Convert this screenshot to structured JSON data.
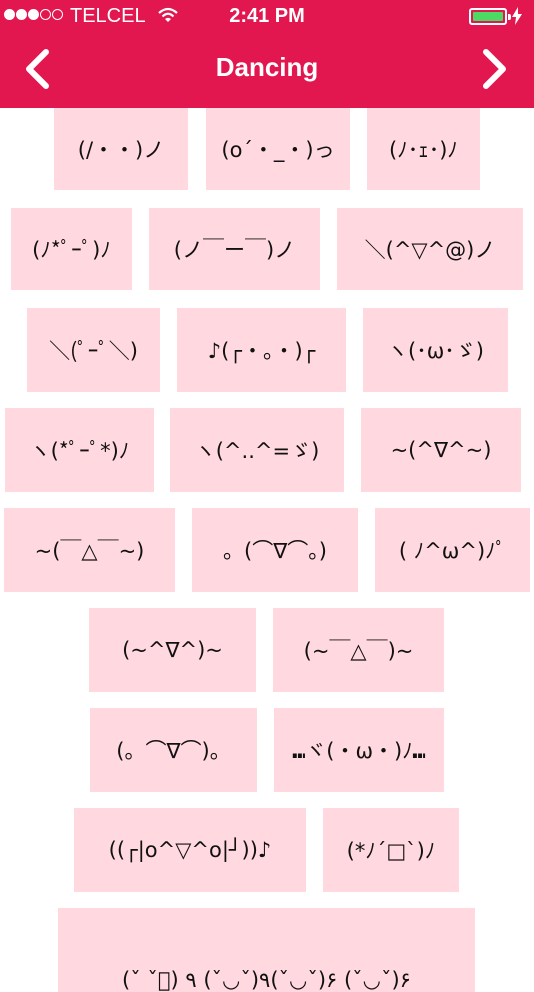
{
  "status_bar": {
    "carrier": "TELCEL",
    "time": "2:41 PM",
    "signal_bars": 3,
    "signal_icon": "signal-dots-icon",
    "wifi_icon": "wifi-icon",
    "battery_level": 1.0,
    "battery_color": "#4cd964",
    "charging_icon": "bolt-icon"
  },
  "nav": {
    "title": "Dancing",
    "back_icon": "chevron-left-icon",
    "next_icon": "chevron-right-icon",
    "color": "#e3174f"
  },
  "emoticons": [
    "(/・・)ノ",
    "(o´・_・)っ",
    "(ﾉ･ｪ･)ﾉ",
    "(ﾉ*ﾟｰﾟ)ﾉ",
    "(ノ￣ー￣)ノ",
    "＼(^▽^@)ノ",
    "＼(ﾟｰﾟ＼)",
    "♪(┌・。・)┌",
    "ヽ(･ω･ゞ)",
    "ヽ(*ﾟｰﾟ*)ﾉ",
    "ヽ(^..^=ゞ)",
    "~(^∇^~)",
    "~(￣△￣~)",
    "。(⌒∇⌒。)",
    "( ﾉ^ω^)ﾉﾟ",
    "(~^∇^)~",
    "(~￣△￣)~",
    "(。⌒∇⌒)。",
    "⑉ヾ(・ω・)ﾉ⑉",
    "((┌|o^▽^o|┘))♪",
    "(*ﾉ´□`)ﾉ",
    "(ˇ ˇ゙) ٩(ˇ◡ˇ) ٩(ˇ◡ˇ)۶ (ˇ◡ˇ)۶"
  ],
  "chip_color": "#ffd8e0"
}
